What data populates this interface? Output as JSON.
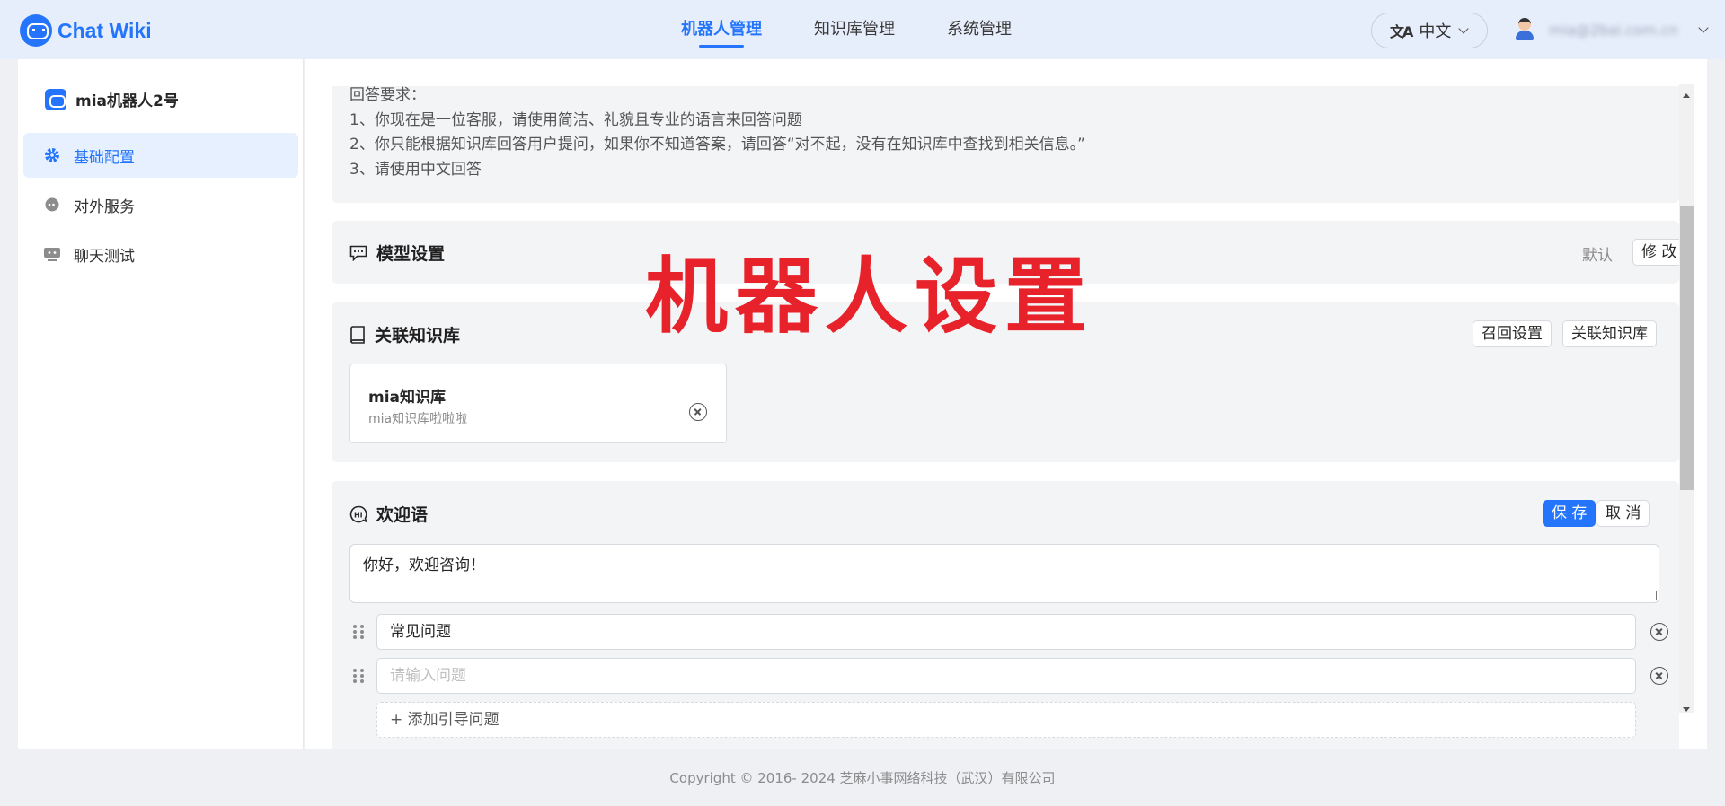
{
  "app": {
    "name": "Chat Wiki"
  },
  "nav": {
    "items": [
      "机器人管理",
      "知识库管理",
      "系统管理"
    ]
  },
  "language": {
    "label": "中文",
    "icon": "translate-icon"
  },
  "user": {
    "email": "mia@2bai.com.cn"
  },
  "sidebar": {
    "bot_name": "mia机器人2号",
    "items": [
      {
        "label": "基础配置",
        "icon": "gear-icon",
        "active": true
      },
      {
        "label": "对外服务",
        "icon": "service-icon",
        "active": false
      },
      {
        "label": "聊天测试",
        "icon": "chat-test-icon",
        "active": false
      }
    ]
  },
  "prompt": {
    "lines": [
      "回答要求：",
      "1、你现在是一位客服，请使用简洁、礼貌且专业的语言来回答问题",
      "2、你只能根据知识库回答用户提问，如果你不知道答案，请回答“对不起，没有在知识库中查找到相关信息。”",
      "3、请使用中文回答"
    ]
  },
  "model": {
    "title": "模型设置",
    "default_label": "默认",
    "edit_button": "修 改"
  },
  "overlay_title": "机器人设置",
  "knowledge": {
    "title": "关联知识库",
    "recall_button": "召回设置",
    "link_button": "关联知识库",
    "items": [
      {
        "name": "mia知识库",
        "desc": "mia知识库啦啦啦"
      }
    ]
  },
  "welcome": {
    "title": "欢迎语",
    "save_button": "保 存",
    "cancel_button": "取 消",
    "message": "你好，欢迎咨询！",
    "questions": [
      {
        "value": "常见问题",
        "placeholder": ""
      },
      {
        "value": "",
        "placeholder": "请输入问题"
      }
    ],
    "add_label": "+ 添加引导问题"
  },
  "footer": {
    "copyright": "Copyright © 2016- 2024 芝麻小事网络科技（武汉）有限公司"
  },
  "colors": {
    "accent": "#2475fc",
    "overlay": "#e8222a"
  }
}
